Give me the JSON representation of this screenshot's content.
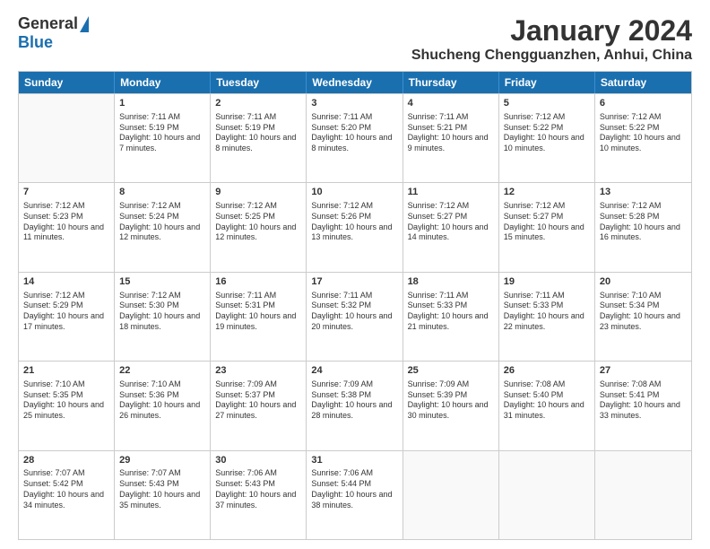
{
  "logo": {
    "general": "General",
    "blue": "Blue"
  },
  "title": "January 2024",
  "location": "Shucheng Chengguanzhen, Anhui, China",
  "days": [
    "Sunday",
    "Monday",
    "Tuesday",
    "Wednesday",
    "Thursday",
    "Friday",
    "Saturday"
  ],
  "weeks": [
    [
      {
        "day": "",
        "empty": true
      },
      {
        "day": "1",
        "sunrise": "Sunrise: 7:11 AM",
        "sunset": "Sunset: 5:19 PM",
        "daylight": "Daylight: 10 hours and 7 minutes."
      },
      {
        "day": "2",
        "sunrise": "Sunrise: 7:11 AM",
        "sunset": "Sunset: 5:19 PM",
        "daylight": "Daylight: 10 hours and 8 minutes."
      },
      {
        "day": "3",
        "sunrise": "Sunrise: 7:11 AM",
        "sunset": "Sunset: 5:20 PM",
        "daylight": "Daylight: 10 hours and 8 minutes."
      },
      {
        "day": "4",
        "sunrise": "Sunrise: 7:11 AM",
        "sunset": "Sunset: 5:21 PM",
        "daylight": "Daylight: 10 hours and 9 minutes."
      },
      {
        "day": "5",
        "sunrise": "Sunrise: 7:12 AM",
        "sunset": "Sunset: 5:22 PM",
        "daylight": "Daylight: 10 hours and 10 minutes."
      },
      {
        "day": "6",
        "sunrise": "Sunrise: 7:12 AM",
        "sunset": "Sunset: 5:22 PM",
        "daylight": "Daylight: 10 hours and 10 minutes."
      }
    ],
    [
      {
        "day": "7",
        "sunrise": "Sunrise: 7:12 AM",
        "sunset": "Sunset: 5:23 PM",
        "daylight": "Daylight: 10 hours and 11 minutes."
      },
      {
        "day": "8",
        "sunrise": "Sunrise: 7:12 AM",
        "sunset": "Sunset: 5:24 PM",
        "daylight": "Daylight: 10 hours and 12 minutes."
      },
      {
        "day": "9",
        "sunrise": "Sunrise: 7:12 AM",
        "sunset": "Sunset: 5:25 PM",
        "daylight": "Daylight: 10 hours and 12 minutes."
      },
      {
        "day": "10",
        "sunrise": "Sunrise: 7:12 AM",
        "sunset": "Sunset: 5:26 PM",
        "daylight": "Daylight: 10 hours and 13 minutes."
      },
      {
        "day": "11",
        "sunrise": "Sunrise: 7:12 AM",
        "sunset": "Sunset: 5:27 PM",
        "daylight": "Daylight: 10 hours and 14 minutes."
      },
      {
        "day": "12",
        "sunrise": "Sunrise: 7:12 AM",
        "sunset": "Sunset: 5:27 PM",
        "daylight": "Daylight: 10 hours and 15 minutes."
      },
      {
        "day": "13",
        "sunrise": "Sunrise: 7:12 AM",
        "sunset": "Sunset: 5:28 PM",
        "daylight": "Daylight: 10 hours and 16 minutes."
      }
    ],
    [
      {
        "day": "14",
        "sunrise": "Sunrise: 7:12 AM",
        "sunset": "Sunset: 5:29 PM",
        "daylight": "Daylight: 10 hours and 17 minutes."
      },
      {
        "day": "15",
        "sunrise": "Sunrise: 7:12 AM",
        "sunset": "Sunset: 5:30 PM",
        "daylight": "Daylight: 10 hours and 18 minutes."
      },
      {
        "day": "16",
        "sunrise": "Sunrise: 7:11 AM",
        "sunset": "Sunset: 5:31 PM",
        "daylight": "Daylight: 10 hours and 19 minutes."
      },
      {
        "day": "17",
        "sunrise": "Sunrise: 7:11 AM",
        "sunset": "Sunset: 5:32 PM",
        "daylight": "Daylight: 10 hours and 20 minutes."
      },
      {
        "day": "18",
        "sunrise": "Sunrise: 7:11 AM",
        "sunset": "Sunset: 5:33 PM",
        "daylight": "Daylight: 10 hours and 21 minutes."
      },
      {
        "day": "19",
        "sunrise": "Sunrise: 7:11 AM",
        "sunset": "Sunset: 5:33 PM",
        "daylight": "Daylight: 10 hours and 22 minutes."
      },
      {
        "day": "20",
        "sunrise": "Sunrise: 7:10 AM",
        "sunset": "Sunset: 5:34 PM",
        "daylight": "Daylight: 10 hours and 23 minutes."
      }
    ],
    [
      {
        "day": "21",
        "sunrise": "Sunrise: 7:10 AM",
        "sunset": "Sunset: 5:35 PM",
        "daylight": "Daylight: 10 hours and 25 minutes."
      },
      {
        "day": "22",
        "sunrise": "Sunrise: 7:10 AM",
        "sunset": "Sunset: 5:36 PM",
        "daylight": "Daylight: 10 hours and 26 minutes."
      },
      {
        "day": "23",
        "sunrise": "Sunrise: 7:09 AM",
        "sunset": "Sunset: 5:37 PM",
        "daylight": "Daylight: 10 hours and 27 minutes."
      },
      {
        "day": "24",
        "sunrise": "Sunrise: 7:09 AM",
        "sunset": "Sunset: 5:38 PM",
        "daylight": "Daylight: 10 hours and 28 minutes."
      },
      {
        "day": "25",
        "sunrise": "Sunrise: 7:09 AM",
        "sunset": "Sunset: 5:39 PM",
        "daylight": "Daylight: 10 hours and 30 minutes."
      },
      {
        "day": "26",
        "sunrise": "Sunrise: 7:08 AM",
        "sunset": "Sunset: 5:40 PM",
        "daylight": "Daylight: 10 hours and 31 minutes."
      },
      {
        "day": "27",
        "sunrise": "Sunrise: 7:08 AM",
        "sunset": "Sunset: 5:41 PM",
        "daylight": "Daylight: 10 hours and 33 minutes."
      }
    ],
    [
      {
        "day": "28",
        "sunrise": "Sunrise: 7:07 AM",
        "sunset": "Sunset: 5:42 PM",
        "daylight": "Daylight: 10 hours and 34 minutes."
      },
      {
        "day": "29",
        "sunrise": "Sunrise: 7:07 AM",
        "sunset": "Sunset: 5:43 PM",
        "daylight": "Daylight: 10 hours and 35 minutes."
      },
      {
        "day": "30",
        "sunrise": "Sunrise: 7:06 AM",
        "sunset": "Sunset: 5:43 PM",
        "daylight": "Daylight: 10 hours and 37 minutes."
      },
      {
        "day": "31",
        "sunrise": "Sunrise: 7:06 AM",
        "sunset": "Sunset: 5:44 PM",
        "daylight": "Daylight: 10 hours and 38 minutes."
      },
      {
        "day": "",
        "empty": true
      },
      {
        "day": "",
        "empty": true
      },
      {
        "day": "",
        "empty": true
      }
    ]
  ]
}
